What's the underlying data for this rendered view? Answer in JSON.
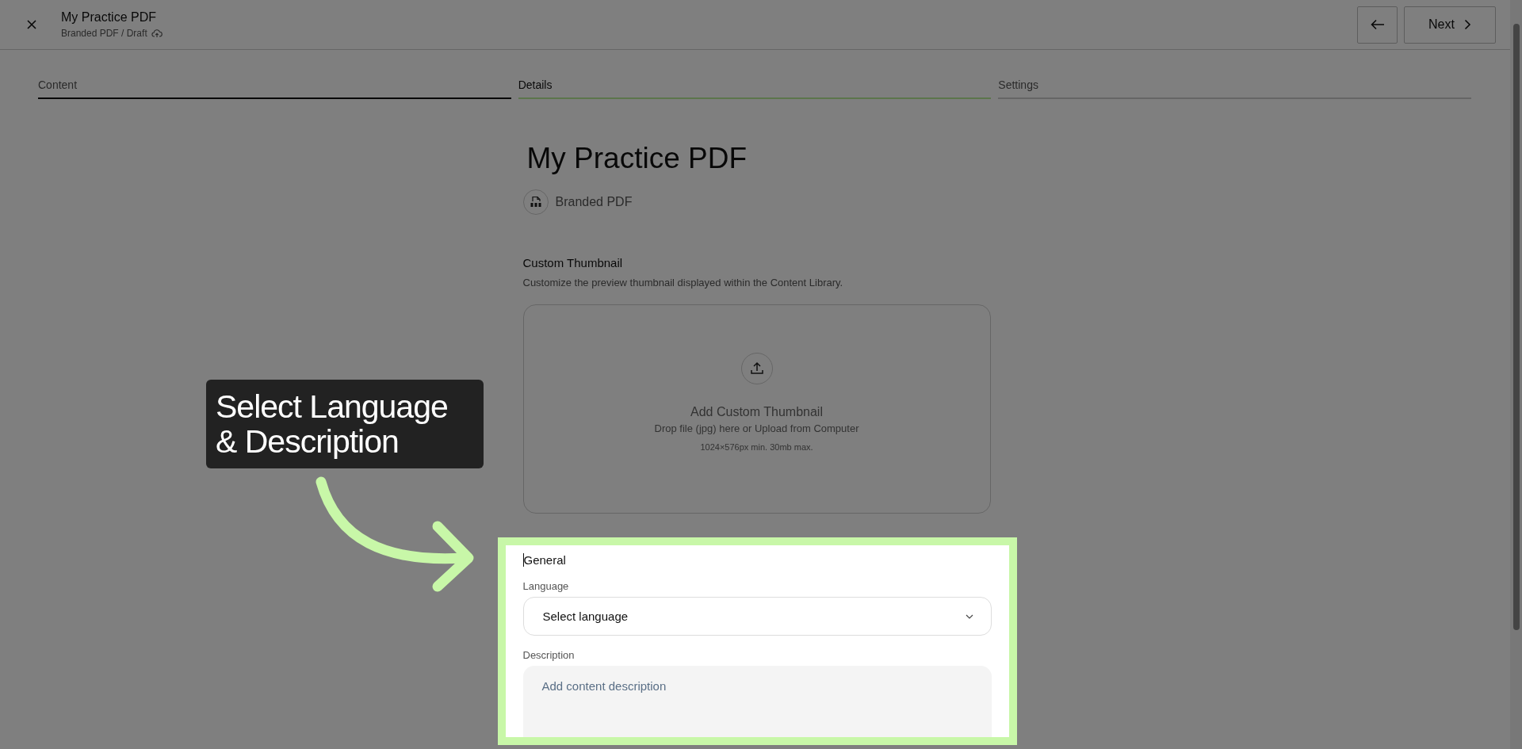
{
  "header": {
    "title": "My Practice PDF",
    "breadcrumb": "Branded PDF / Draft",
    "next_label": "Next"
  },
  "tabs": [
    {
      "label": "Content",
      "selected": false,
      "completed": true
    },
    {
      "label": "Details",
      "selected": true,
      "completed": false
    },
    {
      "label": "Settings",
      "selected": false,
      "completed": false
    }
  ],
  "heading": "My Practice PDF",
  "content_type": "Branded PDF",
  "thumbnail": {
    "title": "Custom Thumbnail",
    "description": "Customize the preview thumbnail displayed within the Content Library.",
    "dropzone": {
      "title": "Add Custom Thumbnail",
      "hint": "Drop file (jpg) here or Upload from Computer",
      "limits": "1024×576px min. 30mb max."
    }
  },
  "general": {
    "title": "General",
    "language": {
      "label": "Language",
      "selection_text": "Select language"
    },
    "description": {
      "label": "Description",
      "placeholder": "Add content description"
    }
  },
  "callout": {
    "text": "Select Language & Description"
  }
}
